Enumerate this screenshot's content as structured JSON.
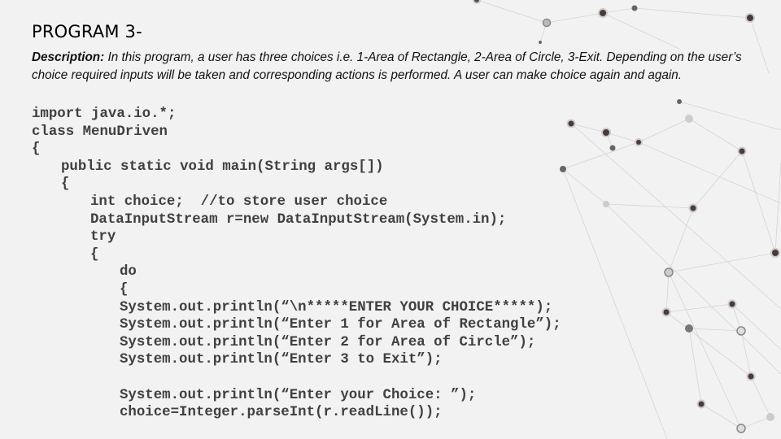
{
  "title": "PROGRAM 3-",
  "description": {
    "label": "Description:",
    "text": " In this program, a user has three choices i.e. 1-Area of Rectangle, 2-Area of Circle, 3-Exit. Depending on the user’s choice required inputs will be taken and corresponding actions is performed. A user can make choice again and again."
  },
  "code_lines": [
    "import java.io.*;",
    "class MenuDriven",
    "{",
    "public static void main(String args[])",
    "{",
    "int choice;  //to store user choice",
    "DataInputStream r=new DataInputStream(System.in);",
    "try",
    "{",
    "do",
    "{",
    "System.out.println(“\\n*****ENTER YOUR CHOICE*****);",
    "System.out.println(“Enter 1 for Area of Rectangle”);",
    "System.out.println(“Enter 2 for Area of Circle”);",
    "System.out.println(“Enter 3 to Exit”);",
    "",
    "System.out.println(“Enter your Choice: ”);",
    "choice=Integer.parseInt(r.readLine());"
  ]
}
